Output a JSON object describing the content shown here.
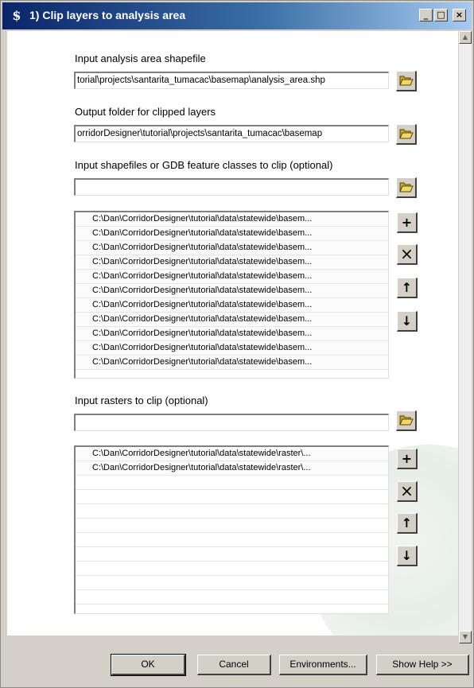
{
  "window": {
    "title_icon": "$",
    "title": "1) Clip layers to analysis area",
    "minimize": "_",
    "maximize": "□",
    "close": "×"
  },
  "fields": {
    "analysis_area_label": "Input analysis area shapefile",
    "analysis_area_value": "torial\\projects\\santarita_tumacac\\basemap\\analysis_area.shp",
    "output_folder_label": "Output folder for clipped layers",
    "output_folder_value": "orridorDesigner\\tutorial\\projects\\santarita_tumacac\\basemap",
    "shapefiles_label": "Input shapefiles or GDB feature classes to clip (optional)",
    "shapefiles_value": "",
    "rasters_label": "Input rasters to clip (optional)",
    "rasters_value": ""
  },
  "shapefile_list": [
    "C:\\Dan\\CorridorDesigner\\tutorial\\data\\statewide\\basem...",
    "C:\\Dan\\CorridorDesigner\\tutorial\\data\\statewide\\basem...",
    "C:\\Dan\\CorridorDesigner\\tutorial\\data\\statewide\\basem...",
    "C:\\Dan\\CorridorDesigner\\tutorial\\data\\statewide\\basem...",
    "C:\\Dan\\CorridorDesigner\\tutorial\\data\\statewide\\basem...",
    "C:\\Dan\\CorridorDesigner\\tutorial\\data\\statewide\\basem...",
    "C:\\Dan\\CorridorDesigner\\tutorial\\data\\statewide\\basem...",
    "C:\\Dan\\CorridorDesigner\\tutorial\\data\\statewide\\basem...",
    "C:\\Dan\\CorridorDesigner\\tutorial\\data\\statewide\\basem...",
    "C:\\Dan\\CorridorDesigner\\tutorial\\data\\statewide\\basem...",
    "C:\\Dan\\CorridorDesigner\\tutorial\\data\\statewide\\basem..."
  ],
  "raster_list": [
    "C:\\Dan\\CorridorDesigner\\tutorial\\data\\statewide\\raster\\...",
    "C:\\Dan\\CorridorDesigner\\tutorial\\data\\statewide\\raster\\..."
  ],
  "list_tools": {
    "add": "+",
    "remove": "×",
    "up": "↑",
    "down": "↓"
  },
  "buttons": {
    "ok": "OK",
    "cancel": "Cancel",
    "environments": "Environments...",
    "show_help": "Show Help >>"
  },
  "icons": {
    "folder": "folder-open-icon",
    "app": "toolbox-icon"
  },
  "colors": {
    "title_start": "#0a246a",
    "title_end": "#a6caf0",
    "dialog_face": "#d4d0c8",
    "folder_yellow": "#e8c850"
  }
}
